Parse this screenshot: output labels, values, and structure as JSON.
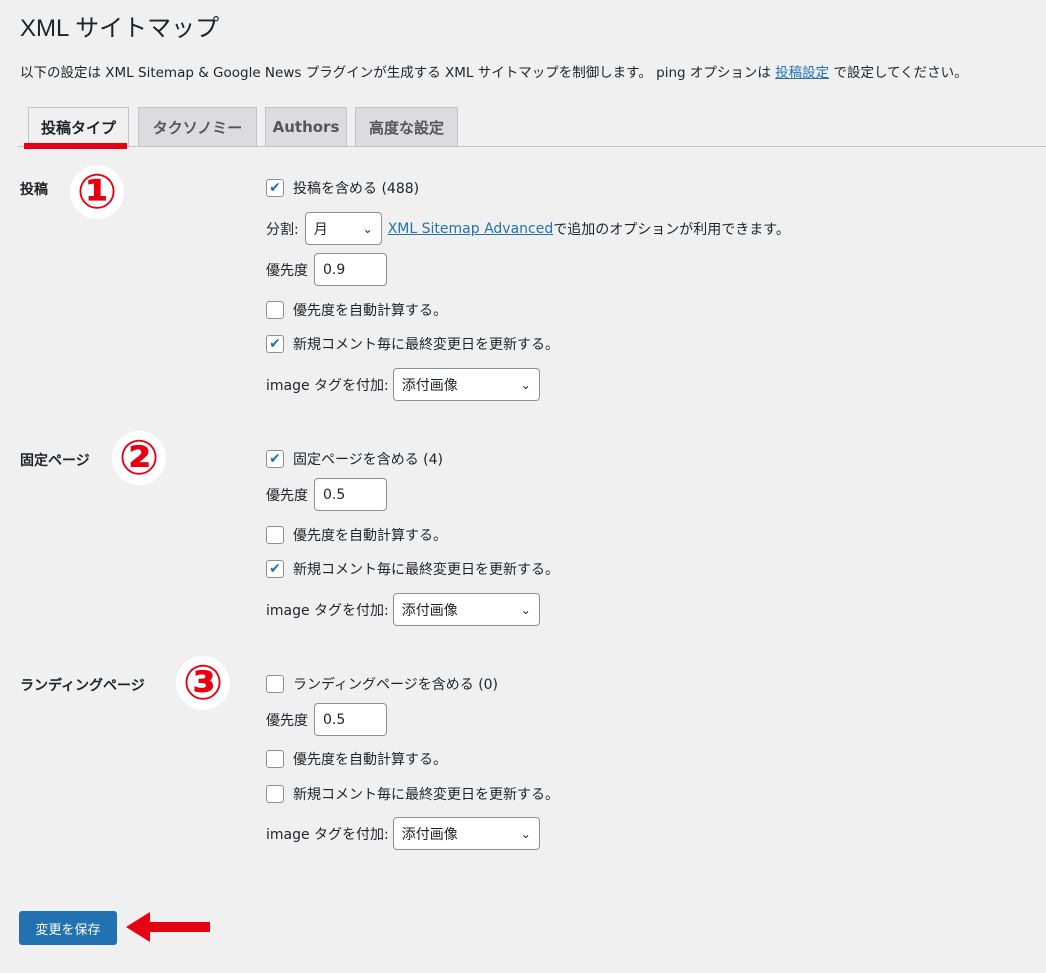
{
  "header": {
    "title": "XML サイトマップ",
    "intro_prefix": "以下の設定は XML Sitemap & Google News プラグインが生成する XML サイトマップを制御します。 ping オプションは ",
    "intro_link": "投稿設定",
    "intro_suffix": " で設定してください。"
  },
  "tabs": [
    {
      "label": "投稿タイプ",
      "active": true
    },
    {
      "label": "タクソノミー",
      "active": false
    },
    {
      "label": "Authors",
      "active": false
    },
    {
      "label": "高度な設定",
      "active": false
    }
  ],
  "annotations": {
    "marker1": "①",
    "marker2": "②",
    "marker3": "③",
    "highlight_color": "#e60012"
  },
  "common": {
    "split_label": "分割:",
    "priority_label": "優先度",
    "auto_priority_label": "優先度を自動計算する。",
    "update_lastmod_label": "新規コメント毎に最終変更日を更新する。",
    "image_tag_label": "image タグを付加:",
    "image_tag_value": "添付画像",
    "advanced_link": "XML Sitemap Advanced",
    "advanced_suffix": " で追加のオプションが利用できます。"
  },
  "sections": {
    "posts": {
      "label": "投稿",
      "include_label": "投稿を含める (488)",
      "include_checked": true,
      "split_value": "月",
      "priority": "0.9",
      "auto_priority": false,
      "update_lastmod": true
    },
    "pages": {
      "label": "固定ページ",
      "include_label": "固定ページを含める (4)",
      "include_checked": true,
      "priority": "0.5",
      "auto_priority": false,
      "update_lastmod": true
    },
    "landing": {
      "label": "ランディングページ",
      "include_label": "ランディングページを含める (0)",
      "include_checked": false,
      "priority": "0.5",
      "auto_priority": false,
      "update_lastmod": false
    }
  },
  "footer": {
    "save_label": "変更を保存"
  },
  "colors": {
    "accent": "#2271b1",
    "background": "#f0f0f1"
  }
}
